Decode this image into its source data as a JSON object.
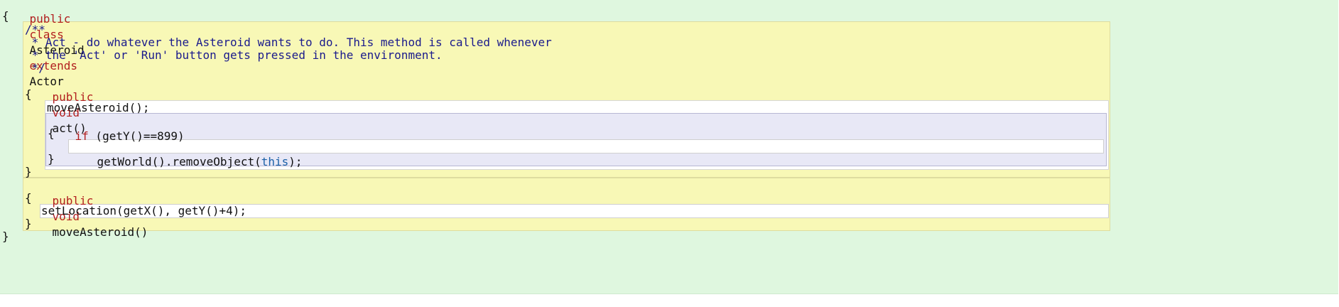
{
  "editor": {
    "class_decl": {
      "kw1": "public",
      "kw2": "class",
      "name": "Asteroid",
      "kw3": "extends",
      "parent": "Actor"
    },
    "open_brace": "{",
    "close_brace": "}",
    "comment": {
      "line1": "/**",
      "line2": " * Act - do whatever the Asteroid wants to do. This method is called whenever",
      "line3": " * the 'Act' or 'Run' button gets pressed in the environment.",
      "line4": " */"
    },
    "act_method": {
      "kw1": "public",
      "kw2": "void",
      "signature": "act()",
      "open_brace": "{",
      "close_brace": "}",
      "stmt_move": "moveAsteroid();",
      "if": {
        "kw": "if",
        "cond": " (getY()==899)",
        "open_brace": "{",
        "close_brace": "}",
        "stmt_prefix": "getWorld().removeObject(",
        "stmt_this": "this",
        "stmt_suffix": ");"
      }
    },
    "move_method": {
      "kw1": "public",
      "kw2": "void",
      "signature": "moveAsteroid()",
      "open_brace": "{",
      "close_brace": "}",
      "stmt": "setLocation(getX(), getY()+4);"
    }
  }
}
